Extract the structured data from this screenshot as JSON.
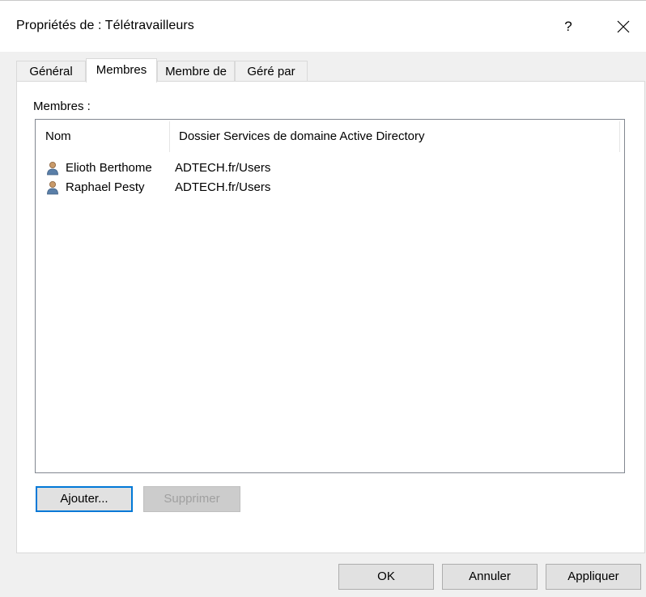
{
  "window": {
    "title": "Propriétés de : Télétravailleurs",
    "help_label": "?"
  },
  "tabs": [
    {
      "label": "Général"
    },
    {
      "label": "Membres"
    },
    {
      "label": "Membre de"
    },
    {
      "label": "Géré par"
    }
  ],
  "members": {
    "label": "Membres :",
    "columns": [
      "Nom",
      "Dossier Services de domaine Active Directory"
    ],
    "rows": [
      {
        "name": "Elioth Berthome",
        "folder": "ADTECH.fr/Users"
      },
      {
        "name": "Raphael Pesty",
        "folder": "ADTECH.fr/Users"
      }
    ],
    "add_button": "Ajouter...",
    "remove_button": "Supprimer"
  },
  "footer": {
    "ok": "OK",
    "cancel": "Annuler",
    "apply": "Appliquer"
  },
  "colors": {
    "accent": "#0078d7",
    "window_bg": "#f0f0f0"
  },
  "icons": {
    "close": "close-icon",
    "user": "user-icon"
  }
}
